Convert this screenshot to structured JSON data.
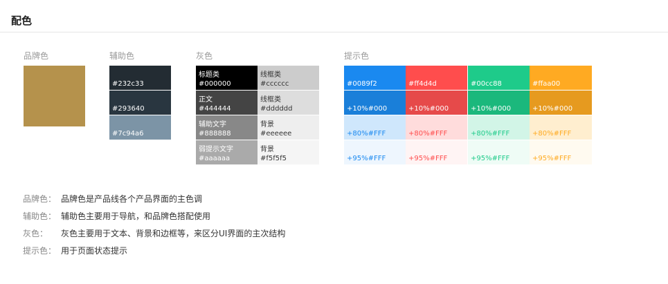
{
  "title": "配色",
  "groups": {
    "brand": {
      "label": "品牌色",
      "swatch": {
        "color": "#b5924c",
        "text": ""
      }
    },
    "aux": {
      "label": "辅助色",
      "swatches": [
        {
          "color": "#232c33",
          "text": "#232c33"
        },
        {
          "color": "#293640",
          "text": "#293640"
        },
        {
          "color": "#7c94a6",
          "text": "#7c94a6"
        }
      ]
    },
    "gray": {
      "label": "灰色",
      "rows": [
        [
          {
            "color": "#000000",
            "top": "标题类",
            "bottom": "#000000",
            "fg": "#ffffff"
          },
          {
            "color": "#cccccc",
            "top": "线框类",
            "bottom": "#cccccc",
            "fg": "#333333"
          }
        ],
        [
          {
            "color": "#444444",
            "top": "正文",
            "bottom": "#444444",
            "fg": "#ffffff"
          },
          {
            "color": "#dddddd",
            "top": "线框类",
            "bottom": "#dddddd",
            "fg": "#333333"
          }
        ],
        [
          {
            "color": "#888888",
            "top": "辅助文字",
            "bottom": "#888888",
            "fg": "#ffffff"
          },
          {
            "color": "#eeeeee",
            "top": "背景",
            "bottom": "#eeeeee",
            "fg": "#333333"
          }
        ],
        [
          {
            "color": "#aaaaaa",
            "top": "弱提示文字",
            "bottom": "#aaaaaa",
            "fg": "#ffffff"
          },
          {
            "color": "#f5f5f5",
            "top": "背景",
            "bottom": "#f5f5f5",
            "fg": "#333333"
          }
        ]
      ]
    },
    "tip": {
      "label": "提示色",
      "rows": [
        [
          {
            "color": "#1a89f0",
            "text": "#0089f2",
            "fg": "#ffffff"
          },
          {
            "color": "#ff4d4d",
            "text": "#ff4d4d",
            "fg": "#ffffff"
          },
          {
            "color": "#1ecb8a",
            "text": "#00cc88",
            "fg": "#ffffff"
          },
          {
            "color": "#ffaa22",
            "text": "#ffaa00",
            "fg": "#ffffff"
          }
        ],
        [
          {
            "color": "#1a7fd9",
            "text": "+10%#000",
            "fg": "#ffffff"
          },
          {
            "color": "#e64a4a",
            "text": "+10%#000",
            "fg": "#ffffff"
          },
          {
            "color": "#1bb87c",
            "text": "+10%#000",
            "fg": "#ffffff"
          },
          {
            "color": "#e69a1f",
            "text": "+10%#000",
            "fg": "#ffffff"
          }
        ],
        [
          {
            "color": "#cfe7fc",
            "text": "+80%#FFF",
            "fg": "#1a89f0"
          },
          {
            "color": "#ffdcdc",
            "text": "+80%#FFF",
            "fg": "#ff4d4d"
          },
          {
            "color": "#d2f5e7",
            "text": "+80%#FFF",
            "fg": "#1ecb8a"
          },
          {
            "color": "#ffeecf",
            "text": "+80%#FFF",
            "fg": "#ffaa22"
          }
        ],
        [
          {
            "color": "#eef6fe",
            "text": "+95%#FFF",
            "fg": "#1a89f0"
          },
          {
            "color": "#fff4f4",
            "text": "+95%#FFF",
            "fg": "#ff4d4d"
          },
          {
            "color": "#effcf6",
            "text": "+95%#FFF",
            "fg": "#1ecb8a"
          },
          {
            "color": "#fffaf0",
            "text": "+95%#FFF",
            "fg": "#ffaa22"
          }
        ]
      ]
    }
  },
  "descriptions": [
    {
      "key": "品牌色：",
      "value": "品牌色是产品线各个产品界面的主色调"
    },
    {
      "key": "辅助色：",
      "value": "辅助色主要用于导航，和品牌色搭配使用"
    },
    {
      "key": "灰色：",
      "value": "灰色主要用于文本、背景和边框等，来区分UI界面的主次结构"
    },
    {
      "key": "提示色：",
      "value": "用于页面状态提示"
    }
  ]
}
